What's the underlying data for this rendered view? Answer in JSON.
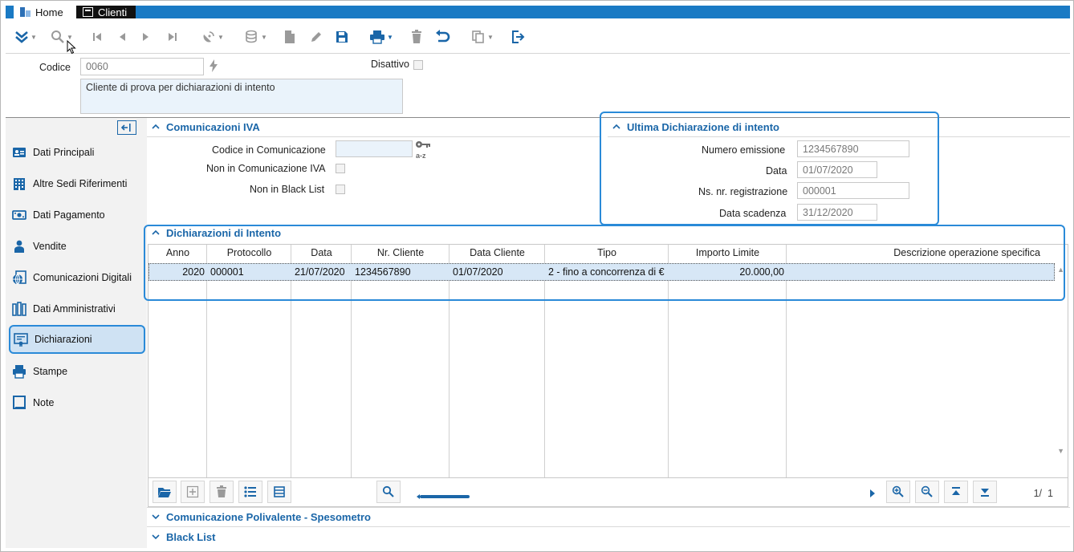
{
  "tabs": [
    {
      "label": "Home"
    },
    {
      "label": "Clienti"
    }
  ],
  "header": {
    "codice_label": "Codice",
    "codice_value": "0060",
    "disattivo_label": "Disattivo",
    "descrizione_value": "Cliente di prova per dichiarazioni di intento"
  },
  "sidebar": {
    "items": [
      {
        "label": "Dati Principali",
        "icon": "contact-card-icon"
      },
      {
        "label": "Altre Sedi Riferimenti",
        "icon": "building-icon"
      },
      {
        "label": "Dati Pagamento",
        "icon": "money-icon"
      },
      {
        "label": "Vendite",
        "icon": "person-icon"
      },
      {
        "label": "Comunicazioni Digitali",
        "icon": "globe-document-icon"
      },
      {
        "label": "Dati Amministrativi",
        "icon": "binders-icon"
      },
      {
        "label": "Dichiarazioni",
        "icon": "certificate-icon"
      },
      {
        "label": "Stampe",
        "icon": "printer-icon"
      },
      {
        "label": "Note",
        "icon": "note-icon"
      }
    ],
    "active_index": 6
  },
  "comunicazioni_iva": {
    "title": "Comunicazioni IVA",
    "codice_label": "Codice in Comunicazione",
    "codice_value": "",
    "non_iva_label": "Non in Comunicazione IVA",
    "black_list_label": "Non in Black List"
  },
  "ultima_dichiarazione": {
    "title": "Ultima Dichiarazione di intento",
    "numero_label": "Numero emissione",
    "numero_value": "1234567890",
    "data_label": "Data",
    "data_value": "01/07/2020",
    "ns_label": "Ns. nr. registrazione",
    "ns_value": "000001",
    "scadenza_label": "Data scadenza",
    "scadenza_value": "31/12/2020"
  },
  "dichiarazioni": {
    "title": "Dichiarazioni di Intento",
    "columns": [
      "Anno",
      "Protocollo",
      "Data",
      "Nr. Cliente",
      "Data Cliente",
      "Tipo",
      "Importo Limite",
      "Descrizione operazione specifica"
    ],
    "rows": [
      [
        "2020",
        "000001",
        "21/07/2020",
        "1234567890",
        "01/07/2020",
        "2 - fino a concorrenza di €",
        "20.000,00",
        ""
      ]
    ],
    "pager_current": "1/",
    "pager_total": "1"
  },
  "sections_collapsed": [
    {
      "title": "Comunicazione Polivalente - Spesometro"
    },
    {
      "title": "Black List"
    }
  ],
  "colors": {
    "accent": "#1a66a8",
    "tabbar": "#1a7ac4",
    "highlight": "#2a8ad8"
  }
}
